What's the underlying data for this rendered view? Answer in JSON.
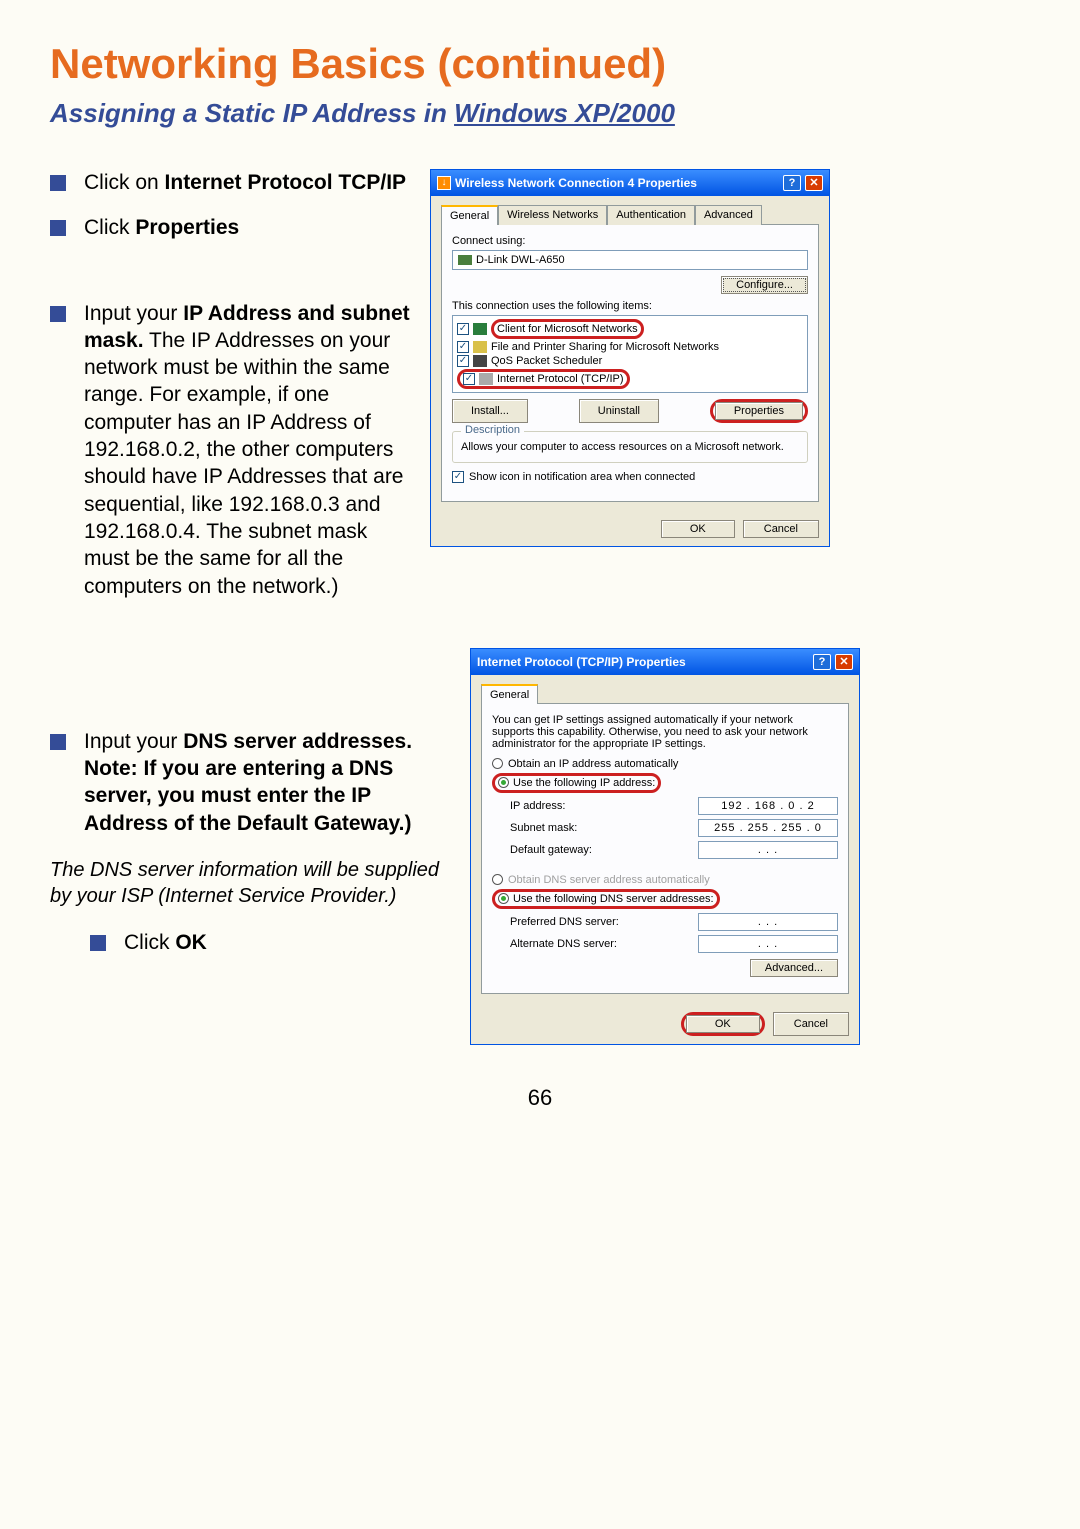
{
  "page": {
    "title": "Networking Basics (continued)",
    "subtitle_prefix": "Assigning a Static IP Address in ",
    "subtitle_underline": "Windows XP/2000",
    "number": "66"
  },
  "bullets": {
    "b1_prefix": "Click on ",
    "b1_bold": "Internet Protocol TCP/IP",
    "b2_prefix": "Click ",
    "b2_bold": "Properties",
    "b3_prefix": "Input your ",
    "b3_bold": "IP Address and subnet mask.",
    "b3_rest": " The IP Addresses on your network must be within the same range. For example, if one computer has an IP Address of 192.168.0.2, the other computers should have IP Addresses that are sequential, like 192.168.0.3 and 192.168.0.4. The subnet mask must be the same for all the computers on the network.)",
    "b4_prefix": "Input your ",
    "b4_bold": "DNS server addresses. Note:  If you are entering a DNS server, you must enter the IP Address of the Default Gateway.)",
    "italic_note": "The DNS server information will be supplied by your ISP (Internet Service Provider.)",
    "b5_prefix": "Click ",
    "b5_bold": "OK"
  },
  "dialog1": {
    "title": "Wireless Network Connection 4 Properties",
    "tabs": [
      "General",
      "Wireless Networks",
      "Authentication",
      "Advanced"
    ],
    "connect_using_label": "Connect using:",
    "adapter": "D-Link DWL-A650",
    "configure_btn": "Configure...",
    "items_label": "This connection uses the following items:",
    "items": [
      "Client for Microsoft Networks",
      "File and Printer Sharing for Microsoft Networks",
      "QoS Packet Scheduler",
      "Internet Protocol (TCP/IP)"
    ],
    "install_btn": "Install...",
    "uninstall_btn": "Uninstall",
    "properties_btn": "Properties",
    "description_label": "Description",
    "description_text": "Allows your computer to access resources on a Microsoft network.",
    "show_icon": "Show icon in notification area when connected",
    "ok": "OK",
    "cancel": "Cancel"
  },
  "dialog2": {
    "title": "Internet Protocol (TCP/IP) Properties",
    "tab": "General",
    "info": "You can get IP settings assigned automatically if your network supports this capability. Otherwise, you need to ask your network administrator for the appropriate IP settings.",
    "opt_auto_ip": "Obtain an IP address automatically",
    "opt_use_ip": "Use the following IP address:",
    "ip_label": "IP address:",
    "ip_value": "192 . 168 .  0  .  2",
    "subnet_label": "Subnet mask:",
    "subnet_value": "255 . 255 . 255 .  0",
    "gateway_label": "Default gateway:",
    "gateway_value": " .        .        . ",
    "opt_auto_dns": "Obtain DNS server address automatically",
    "opt_use_dns": "Use the following DNS server addresses:",
    "pref_dns_label": "Preferred DNS server:",
    "pref_dns_value": " .        .        . ",
    "alt_dns_label": "Alternate DNS server:",
    "alt_dns_value": " .        .        . ",
    "advanced_btn": "Advanced...",
    "ok": "OK",
    "cancel": "Cancel"
  }
}
